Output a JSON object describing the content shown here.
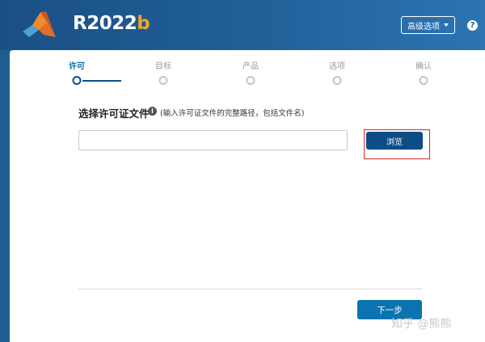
{
  "header": {
    "version_main": "R2022",
    "version_suffix": "b",
    "advanced_label": "高级选项",
    "help_symbol": "?"
  },
  "steps": [
    {
      "label": "许可",
      "active": true
    },
    {
      "label": "目标",
      "active": false
    },
    {
      "label": "产品",
      "active": false
    },
    {
      "label": "选项",
      "active": false
    },
    {
      "label": "确认",
      "active": false
    }
  ],
  "license": {
    "title": "选择许可证文件",
    "info_symbol": "i",
    "hint": "(输入许可证文件的完整路径，包括文件名)",
    "path_value": "",
    "browse_label": "浏览"
  },
  "footer": {
    "next_label": "下一步"
  },
  "watermark": "知乎 @熊熊",
  "colors": {
    "brand_blue": "#1f5d93",
    "accent_orange": "#f0a22b",
    "primary_button": "#0d4d86",
    "next_button": "#0c73b0",
    "highlight_red": "#d42a2a"
  }
}
